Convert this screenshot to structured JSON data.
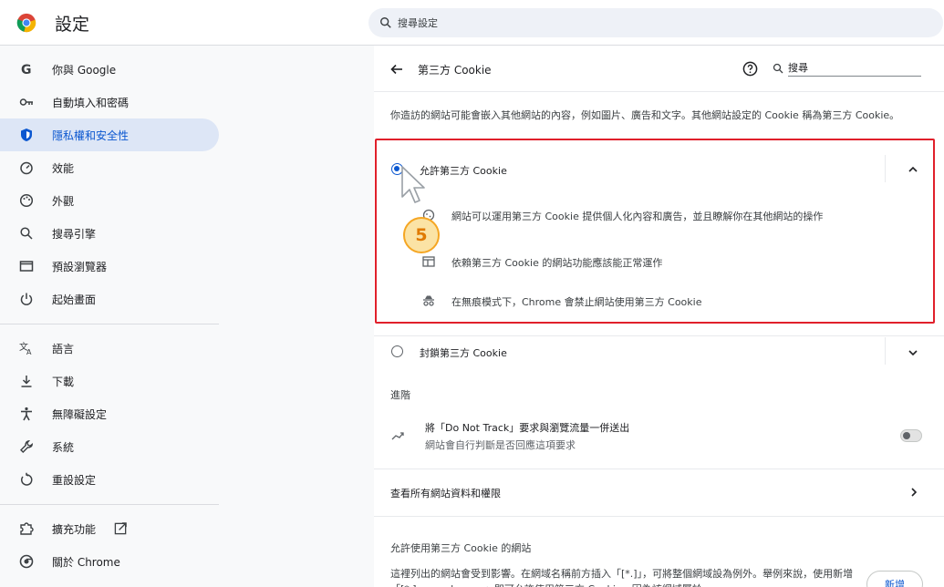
{
  "header": {
    "title": "設定",
    "search_placeholder": "搜尋設定"
  },
  "sidebar": {
    "items": [
      {
        "label": "你與 Google",
        "icon": "google-g-icon"
      },
      {
        "label": "自動填入和密碼",
        "icon": "key-icon"
      },
      {
        "label": "隱私權和安全性",
        "icon": "shield-icon",
        "active": true
      },
      {
        "label": "效能",
        "icon": "speedometer-icon"
      },
      {
        "label": "外觀",
        "icon": "palette-icon"
      },
      {
        "label": "搜尋引擎",
        "icon": "search-icon"
      },
      {
        "label": "預設瀏覽器",
        "icon": "browser-window-icon"
      },
      {
        "label": "起始畫面",
        "icon": "power-icon"
      },
      {
        "label": "語言",
        "icon": "translate-icon"
      },
      {
        "label": "下載",
        "icon": "download-icon"
      },
      {
        "label": "無障礙設定",
        "icon": "accessibility-icon"
      },
      {
        "label": "系統",
        "icon": "wrench-icon"
      },
      {
        "label": "重設設定",
        "icon": "reset-icon"
      },
      {
        "label": "擴充功能",
        "icon": "puzzle-icon"
      },
      {
        "label": "關於 Chrome",
        "icon": "chrome-icon"
      }
    ]
  },
  "main": {
    "title": "第三方 Cookie",
    "search_placeholder": "搜尋",
    "description": "你造訪的網站可能會嵌入其他網站的內容，例如圖片、廣告和文字。其他網站設定的 Cookie 稱為第三方 Cookie。",
    "option_allow": {
      "label": "允許第三方 Cookie",
      "details": [
        "網站可以運用第三方 Cookie 提供個人化內容和廣告，並且瞭解你在其他網站的操作",
        "依賴第三方 Cookie 的網站功能應該能正常運作",
        "在無痕模式下，Chrome 會禁止網站使用第三方 Cookie"
      ]
    },
    "option_block": {
      "label": "封鎖第三方 Cookie"
    },
    "advanced_heading": "進階",
    "dnt": {
      "title": "將「Do Not Track」要求與瀏覽流量一併送出",
      "subtitle": "網站會自行判斷是否回應這項要求"
    },
    "all_site_data": "查看所有網站資料和權限",
    "allowed_sites_heading": "允許使用第三方 Cookie 的網站",
    "allowed_sites_desc": "這裡列出的網站會受到影響。在網域名稱前方插入「[*.]」，可將整個網域設為例外。舉例來說，使用新增「[*.]example.com」即可允許使用第三方 Cookie，因為該網域屬於",
    "add_button": "新增"
  },
  "overlay": {
    "step_number": "5"
  },
  "colors": {
    "accent": "#0b57d0",
    "highlight": "#e0202b",
    "active_nav_bg": "#dde6f6"
  }
}
